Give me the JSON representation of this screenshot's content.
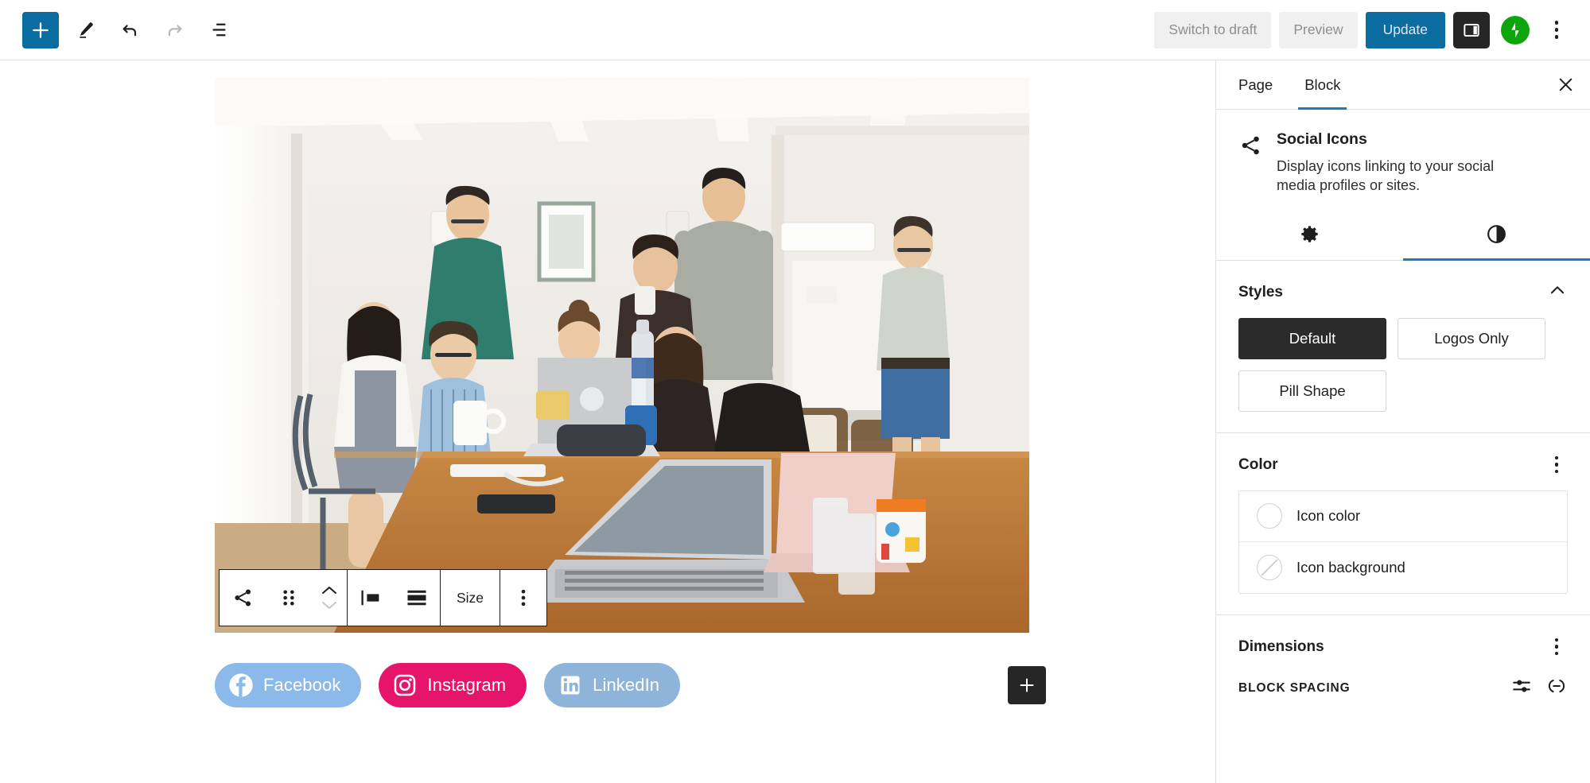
{
  "topbar": {
    "add_block_label": "+",
    "tools": [
      {
        "name": "add-block-icon",
        "label": "Add block"
      },
      {
        "name": "edit-pencil-icon",
        "label": "Tools"
      },
      {
        "name": "undo-icon",
        "label": "Undo"
      },
      {
        "name": "redo-icon",
        "label": "Redo"
      },
      {
        "name": "list-view-icon",
        "label": "Document Overview"
      }
    ],
    "switch_to_draft_label": "Switch to draft",
    "preview_label": "Preview",
    "update_label": "Update",
    "sidebar_toggle_label": "Settings",
    "jetpack_label": "Jetpack",
    "options_label": "Options"
  },
  "canvas": {
    "block_toolbar": {
      "block_type_icon": "social-share-icon",
      "drag_handle_label": "Drag",
      "move_up_label": "Move up",
      "move_down_label": "Move down",
      "align_icon": "align-left-icon",
      "justify_icon": "justify-items-icon",
      "size_label": "Size",
      "options_label": "Options"
    },
    "social_links": [
      {
        "name": "facebook",
        "label": "Facebook",
        "color": "#8ab9ea",
        "icon": "facebook-icon"
      },
      {
        "name": "instagram",
        "label": "Instagram",
        "color": "#e6156b",
        "icon": "instagram-icon"
      },
      {
        "name": "linkedin",
        "label": "LinkedIn",
        "color": "#8fb4d9",
        "icon": "linkedin-icon"
      }
    ],
    "appender_label": "+"
  },
  "sidebar": {
    "tabs": [
      {
        "label": "Page",
        "active": false
      },
      {
        "label": "Block",
        "active": true
      }
    ],
    "close_label": "Close settings",
    "block": {
      "icon": "social-share-icon",
      "title": "Social Icons",
      "description": "Display icons linking to your social media profiles or sites."
    },
    "panel_tabs": [
      {
        "name": "settings-tab",
        "icon": "gear-icon",
        "active": false
      },
      {
        "name": "styles-tab",
        "icon": "contrast-icon",
        "active": true
      }
    ],
    "styles": {
      "title": "Styles",
      "collapse_label": "Collapse",
      "options": [
        {
          "label": "Default",
          "selected": true
        },
        {
          "label": "Logos Only",
          "selected": false
        },
        {
          "label": "Pill Shape",
          "selected": false
        }
      ]
    },
    "color": {
      "title": "Color",
      "options_label": "Color options",
      "items": [
        {
          "label": "Icon color",
          "swatch": "empty"
        },
        {
          "label": "Icon background",
          "swatch": "none"
        }
      ]
    },
    "dimensions": {
      "title": "Dimensions",
      "options_label": "Dimensions options",
      "block_spacing_label": "BLOCK SPACING",
      "controls_icon": "sliders-icon",
      "link_icon": "link-sides-icon"
    }
  },
  "theme": {
    "accent_blue": "#0b6ca0",
    "tab_underline": "#1b7cb8",
    "dark": "#262626",
    "jetpack_green": "#0ca60c"
  }
}
